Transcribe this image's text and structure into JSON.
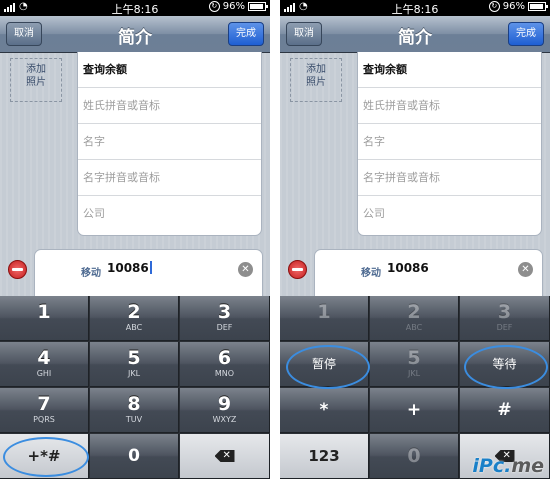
{
  "status_bar": {
    "time": "上午8:16",
    "battery": "96%"
  },
  "nav": {
    "cancel_label": "取消",
    "title": "简介",
    "done_label": "完成"
  },
  "photo_placeholder": {
    "line1": "添加",
    "line2": "照片"
  },
  "name_fields": [
    "查询余额",
    "姓氏拼音或音标",
    "名字",
    "名字拼音或音标",
    "公司"
  ],
  "phone_field": {
    "label": "移动",
    "value": "10086"
  },
  "left_keypad": [
    {
      "digit": "1",
      "letters": ""
    },
    {
      "digit": "2",
      "letters": "ABC"
    },
    {
      "digit": "3",
      "letters": "DEF"
    },
    {
      "digit": "4",
      "letters": "GHI"
    },
    {
      "digit": "5",
      "letters": "JKL"
    },
    {
      "digit": "6",
      "letters": "MNO"
    },
    {
      "digit": "7",
      "letters": "PQRS"
    },
    {
      "digit": "8",
      "letters": "TUV"
    },
    {
      "digit": "9",
      "letters": "WXYZ"
    },
    {
      "symbol": "+*#"
    },
    {
      "digit": "0"
    }
  ],
  "right_keypad": {
    "dim_keys": [
      {
        "digit": "1",
        "letters": ""
      },
      {
        "digit": "2",
        "letters": "ABC"
      },
      {
        "digit": "3",
        "letters": "DEF"
      },
      {
        "digit": "5",
        "letters": "JKL"
      },
      {
        "digit": "0"
      }
    ],
    "pause_label": "暂停",
    "wait_label": "等待",
    "star": "*",
    "plus": "+",
    "hash": "#",
    "back_label": "123"
  },
  "watermark": {
    "part1": "iPc.",
    "part2": "me"
  },
  "colors": {
    "nav_top": "#b7c2cf",
    "done_blue": "#1e5fd3",
    "highlight_ellipse": "#3b8de0"
  }
}
